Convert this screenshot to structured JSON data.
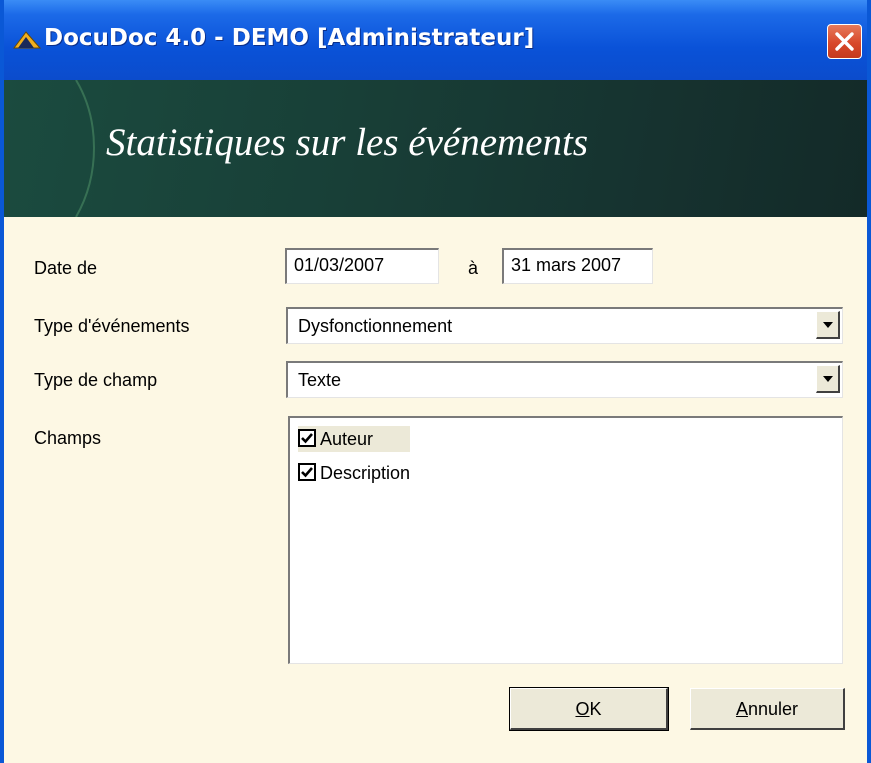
{
  "window": {
    "title": "DocuDoc 4.0 - DEMO [Administrateur]",
    "close_icon": "close-icon"
  },
  "banner": {
    "title": "Statistiques sur les événements"
  },
  "form": {
    "date_label": "Date de",
    "date_from": "01/03/2007",
    "date_sep": "à",
    "date_to": "31 mars 2007",
    "event_type_label": "Type d'événements",
    "event_type_value": "Dysfonctionnement",
    "field_type_label": "Type de champ",
    "field_type_value": "Texte",
    "fields_label": "Champs",
    "fields": [
      {
        "label": "Auteur",
        "checked": true
      },
      {
        "label": "Description",
        "checked": true
      }
    ]
  },
  "buttons": {
    "ok_mnemonic": "O",
    "ok_rest": "K",
    "cancel_mnemonic": "A",
    "cancel_rest": "nnuler"
  },
  "colors": {
    "titlebar": "#0a52d8",
    "banner": "#183f37",
    "body": "#fdf8e4",
    "close": "#d8482a"
  }
}
